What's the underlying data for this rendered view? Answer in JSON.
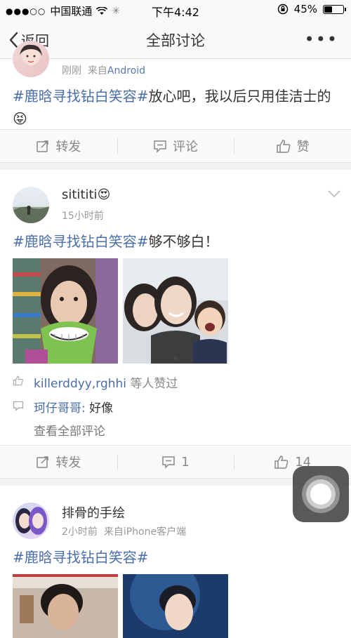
{
  "status_bar": {
    "carrier": "中国联通",
    "time": "下午4:42",
    "battery": "45%",
    "battery_level": 0.45
  },
  "nav": {
    "back_label": "返回",
    "title": "全部讨论",
    "more": "•••"
  },
  "posts": [
    {
      "time": "刚刚",
      "source_prefix": "来自",
      "source": "Android",
      "topic": "#鹿晗寻找钻白笑容#",
      "body": "放心吧，我以后只用佳洁士的",
      "emoji": "😝",
      "actions": {
        "repost": "转发",
        "comment": "评论",
        "like": "赞"
      }
    },
    {
      "name": "sitititi",
      "name_emoji": "😍",
      "time": "15小时前",
      "topic": "#鹿晗寻找钻白笑容#",
      "body": "够不够白！",
      "likers": "killerddyy,rghhi",
      "likers_suffix": "等人赞过",
      "comment_user": "珂仔哥哥:",
      "comment_text": "好像",
      "view_all": "查看全部评论",
      "actions": {
        "repost": "转发",
        "comment": "1",
        "like": "14"
      }
    },
    {
      "name": "排骨的手绘",
      "time": "2小时前",
      "source_prefix": "来自",
      "source": "iPhone客户端",
      "topic": "#鹿晗寻找钻白笑容#"
    }
  ],
  "colors": {
    "topic": "#4a6ea9",
    "meta": "#999999",
    "background": "#f2f2f2"
  }
}
